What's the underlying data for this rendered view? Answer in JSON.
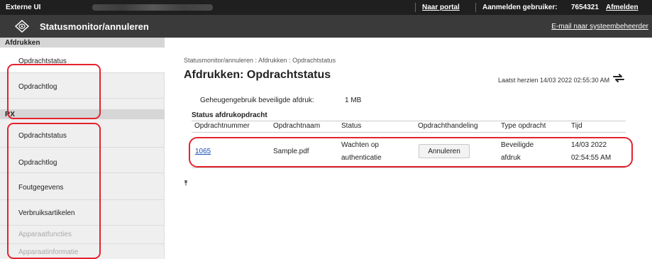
{
  "topbar": {
    "app_name": "Externe UI",
    "portal_link": "Naar portal",
    "login_label": "Aanmelden gebruiker:",
    "user_id": "7654321",
    "logout_link": "Afmelden"
  },
  "header": {
    "title": "Statusmonitor/annuleren",
    "mail_link": "E-mail naar systeembeheerder"
  },
  "sidebar": {
    "section_print": "Afdrukken",
    "print_items": [
      "Opdrachtstatus",
      "Opdrachtlog"
    ],
    "section_rx": "RX",
    "rx_items": [
      "Opdrachtstatus",
      "Opdrachtlog"
    ],
    "other_items": [
      "Foutgegevens",
      "Verbruiksartikelen",
      "Apparaatfuncties",
      "Apparaatinformatie"
    ]
  },
  "main": {
    "breadcrumb": "Statusmonitor/annuleren : Afdrukken : Opdrachtstatus",
    "title": "Afdrukken: Opdrachtstatus",
    "updated": "Laatst herzien 14/03 2022 02:55:30 AM",
    "memory_label": "Geheugengebruik beveiligde afdruk:",
    "memory_value": "1 MB",
    "table_caption": "Status afdrukopdracht",
    "columns": [
      "Opdrachtnummer",
      "Opdrachtnaam",
      "Status",
      "Opdrachthandeling",
      "Type opdracht",
      "Tijd"
    ],
    "rows": [
      {
        "number": "1065",
        "name": "Sample.pdf",
        "status_line1": "Wachten op",
        "status_line2": "authenticatie",
        "action": "Annuleren",
        "type_line1": "Beveiligde",
        "type_line2": "afdruk",
        "time_line1": "14/03 2022",
        "time_line2": "02:54:55 AM"
      }
    ]
  },
  "colors": {
    "highlight": "#e4232e",
    "topbar_bg": "#1f1f1f",
    "header_bg": "#3a3a3a",
    "link": "#1a4fb4"
  },
  "icons": {
    "logo": "diamond-logo-icon",
    "refresh": "refresh-icon",
    "top": "scroll-to-top-icon"
  }
}
